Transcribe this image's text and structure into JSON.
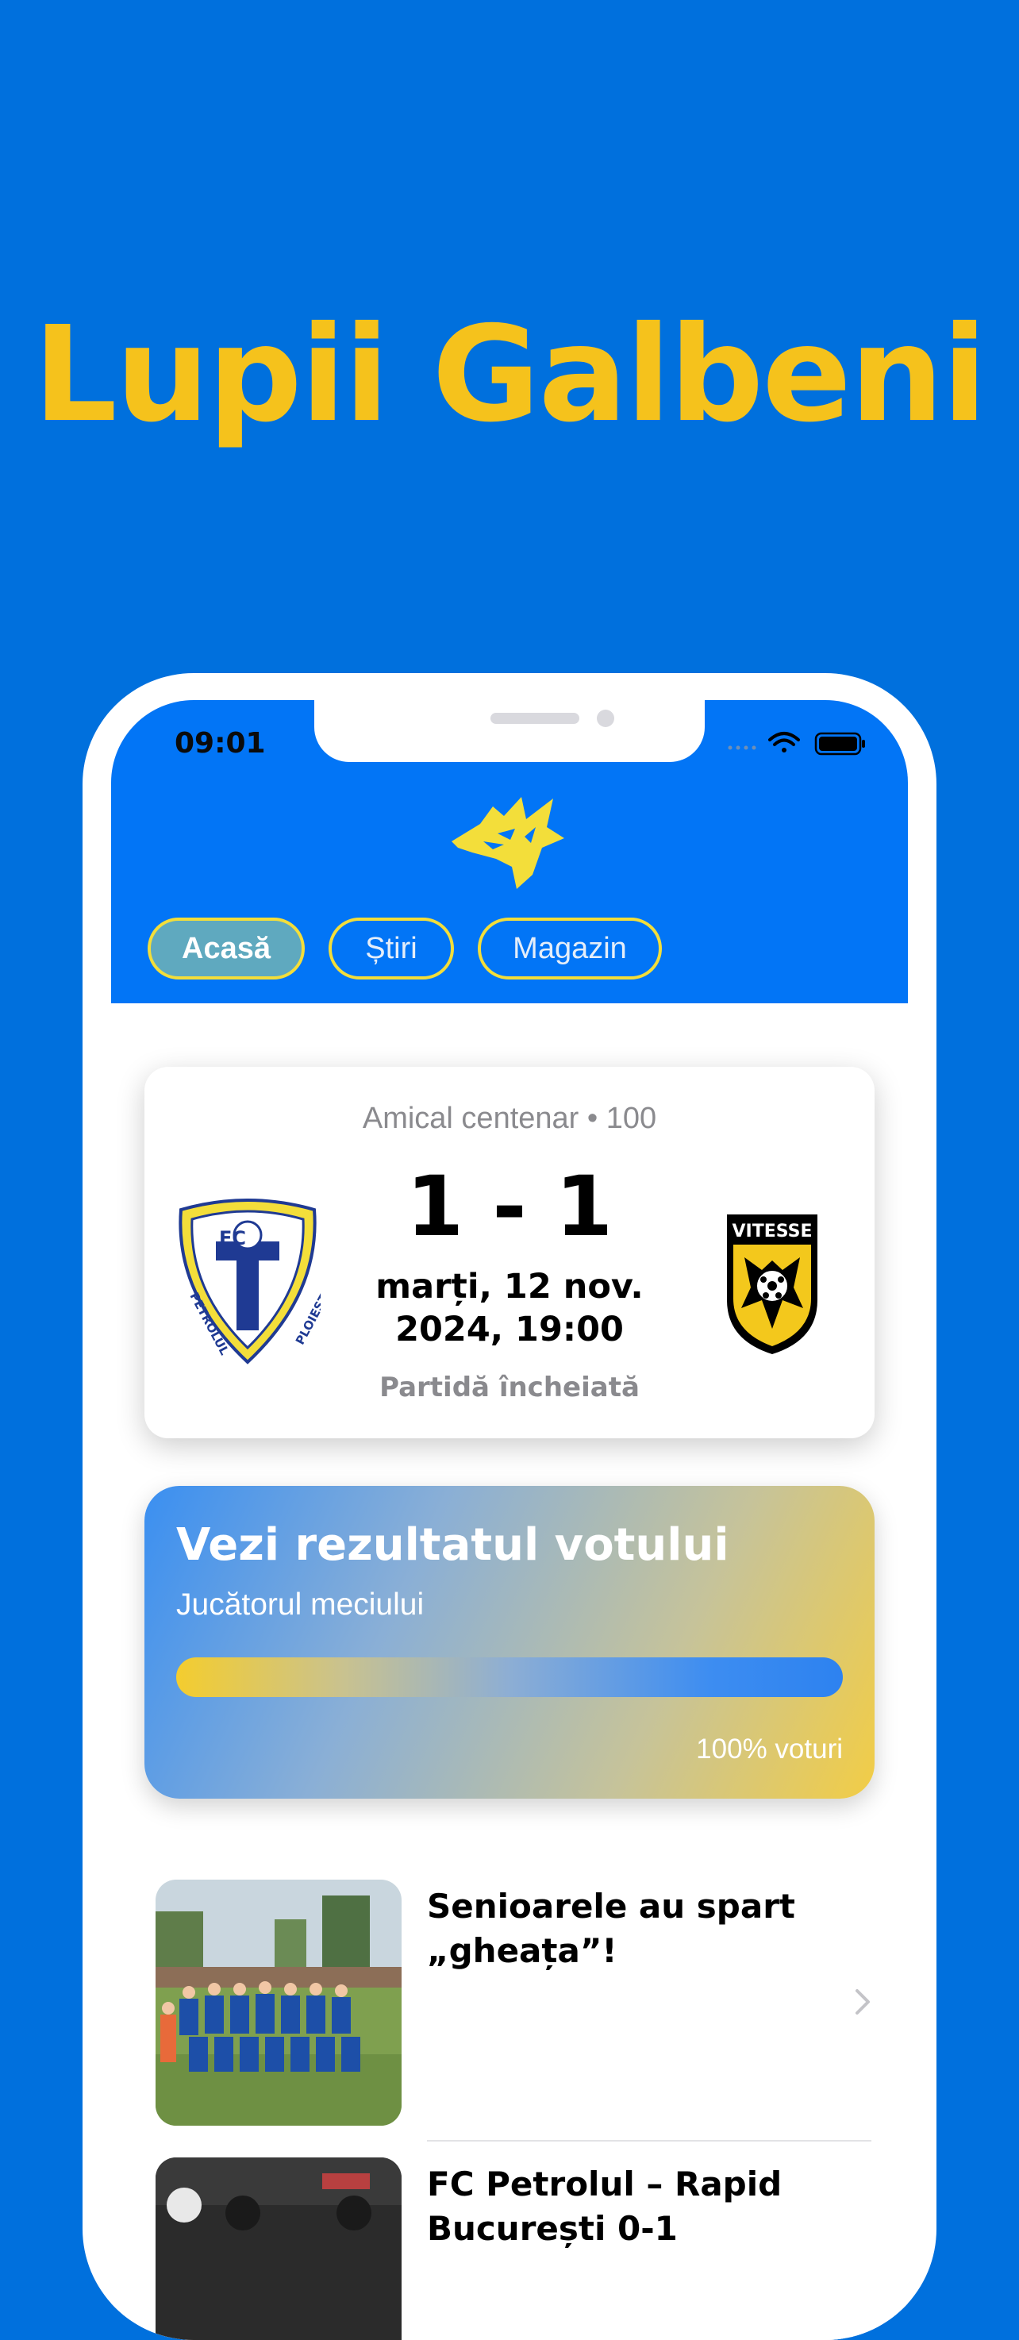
{
  "headline": "Lupii Galbeni",
  "status_bar": {
    "time": "09:01",
    "icons": [
      "signal-icon",
      "wifi-icon",
      "battery-icon"
    ]
  },
  "header": {
    "logo": "wolf-logo-icon",
    "tabs": [
      {
        "label": "Acasă",
        "active": true
      },
      {
        "label": "Știri",
        "active": false
      },
      {
        "label": "Magazin",
        "active": false
      }
    ]
  },
  "match": {
    "event": "Amical centenar • 100",
    "home_crest": "fc-petrolul-ploiesti-crest",
    "home_crest_text": [
      "FC",
      "PETROLUL",
      "PLOIEȘTI"
    ],
    "away_crest": "vitesse-crest",
    "away_crest_text": "VITESSE",
    "score": "1 - 1",
    "date": "marți, 12 nov. 2024, 19:00",
    "status": "Partidă încheiată"
  },
  "vote": {
    "title": "Vezi rezultatul votului",
    "subtitle": "Jucătorul meciului",
    "progress": 1.0,
    "percent_label": "100% voturi"
  },
  "news": [
    {
      "title": "Senioarele au spart „gheața”!",
      "thumb": "women-team-photo"
    },
    {
      "title": "FC Petrolul – Rapid București 0-1",
      "thumb": "match-action-photo"
    }
  ],
  "colors": {
    "background": "#0070DD",
    "headline": "#F5C21C",
    "header": "#0275F6",
    "tab_border": "#F3DE3A",
    "tab_active": "#5FA9BF"
  }
}
